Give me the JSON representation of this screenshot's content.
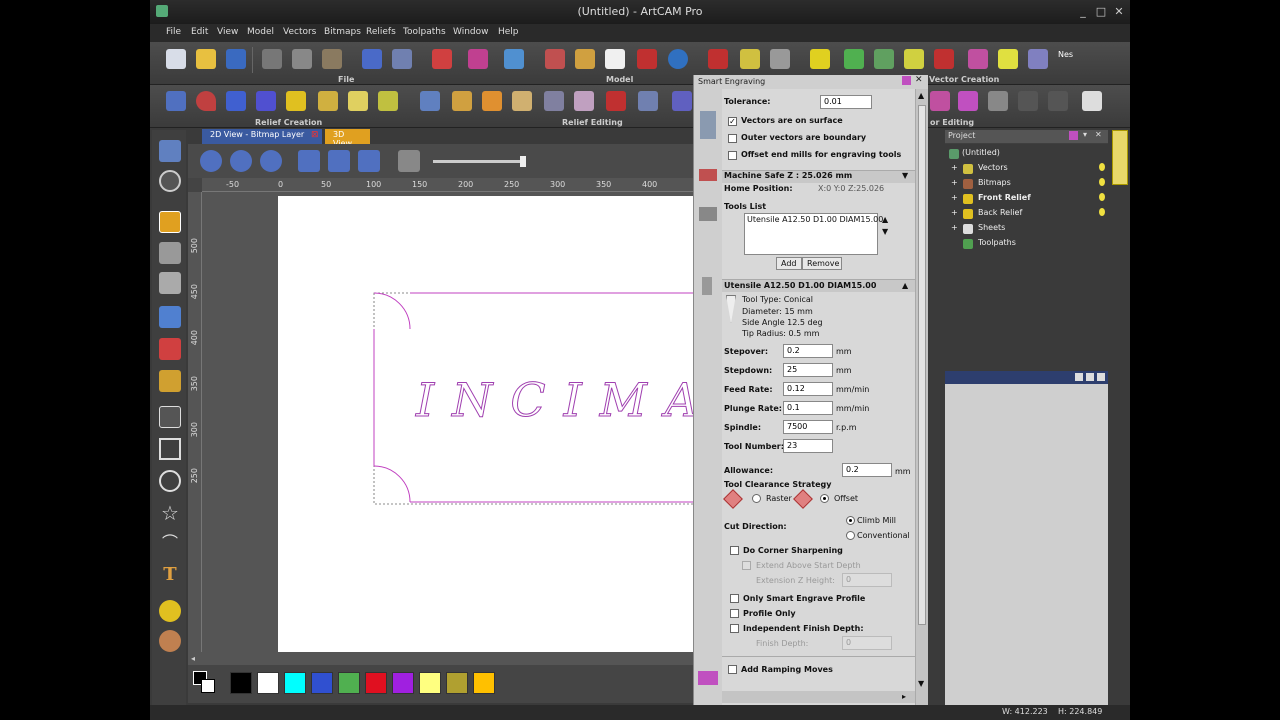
{
  "window": {
    "title": "(Untitled) - ArtCAM Pro",
    "minimize": "_",
    "maximize": "□",
    "close": "✕"
  },
  "menu": [
    "File",
    "Edit",
    "View",
    "Model",
    "Vectors",
    "Bitmaps",
    "Reliefs",
    "Toolpaths",
    "Window",
    "Help"
  ],
  "toolbars": {
    "file_label": "File",
    "model_label": "Model",
    "vector_creation_label": "Vector Creation",
    "relief_creation_label": "Relief Creation",
    "relief_editing_label": "Relief Editing",
    "vector_editing_label": "or Editing"
  },
  "view": {
    "tab_2d": "2D View - Bitmap Layer",
    "tab_close": "⊠",
    "tab_3d": "3D View",
    "ruler_h": [
      "-50",
      "0",
      "50",
      "100",
      "150",
      "200",
      "250",
      "300",
      "350",
      "400"
    ],
    "ruler_v": [
      "500",
      "450",
      "400",
      "350",
      "300",
      "250"
    ],
    "engraved_text": "INCIMA"
  },
  "palette": {
    "colors": [
      "#000000",
      "#ffffff",
      "#00ffff",
      "#3050d0",
      "#50b050",
      "#e01020",
      "#a020e0",
      "#ffff80",
      "#b0a030",
      "#ffc000"
    ]
  },
  "smart_engraving": {
    "title": "Smart Engraving",
    "tolerance_label": "Tolerance:",
    "tolerance_value": "0.01",
    "vectors_on_surface": "Vectors are on surface",
    "outer_vectors_boundary": "Outer vectors are boundary",
    "offset_end_mills": "Offset end mills for engraving tools",
    "machine_safe_z": "Machine Safe Z : 25.026 mm",
    "home_position_label": "Home Position:",
    "home_position_value": "X:0 Y:0 Z:25.026",
    "tools_list_label": "Tools List",
    "tools_list_item": "Utensile A12.50 D1.00 DIAM15.00",
    "add_button": "Add",
    "remove_button": "Remove",
    "tool_name": "Utensile A12.50 D1.00 DIAM15.00",
    "tool_type": "Tool Type: Conical",
    "diameter": "Diameter: 15 mm",
    "side_angle": "Side Angle 12.5 deg",
    "tip_radius": "Tip Radius: 0.5 mm",
    "stepover_label": "Stepover:",
    "stepover_value": "0.2",
    "stepdown_label": "Stepdown:",
    "stepdown_value": "25",
    "feed_rate_label": "Feed Rate:",
    "feed_rate_value": "0.12",
    "plunge_rate_label": "Plunge Rate:",
    "plunge_rate_value": "0.1",
    "spindle_label": "Spindle:",
    "spindle_value": "7500",
    "tool_number_label": "Tool Number:",
    "tool_number_value": "23",
    "unit_mm": "mm",
    "unit_mm_min": "mm/min",
    "unit_rpm": "r.p.m",
    "allowance_label": "Allowance:",
    "allowance_value": "0.2",
    "clearance_strategy_label": "Tool Clearance Strategy",
    "raster_label": "Raster",
    "offset_label": "Offset",
    "cut_direction_label": "Cut Direction:",
    "climb_mill_label": "Climb Mill",
    "conventional_label": "Conventional",
    "do_corner_sharpening": "Do Corner Sharpening",
    "extend_above": "Extend Above Start Depth",
    "extension_z_height": "Extension Z Height:",
    "extension_value": "0",
    "only_smart_engrave_profile": "Only Smart Engrave Profile",
    "profile_only": "Profile Only",
    "independent_finish_depth": "Independent Finish Depth:",
    "finish_depth_label": "Finish Depth:",
    "finish_depth_value": "0",
    "add_ramping_moves": "Add Ramping Moves"
  },
  "project": {
    "header": "Project",
    "items": [
      "(Untitled)",
      "Vectors",
      "Bitmaps",
      "Front Relief",
      "Back Relief",
      "Sheets",
      "Toolpaths"
    ]
  },
  "status": {
    "width": "W: 412.223",
    "height": "H: 224.849"
  }
}
